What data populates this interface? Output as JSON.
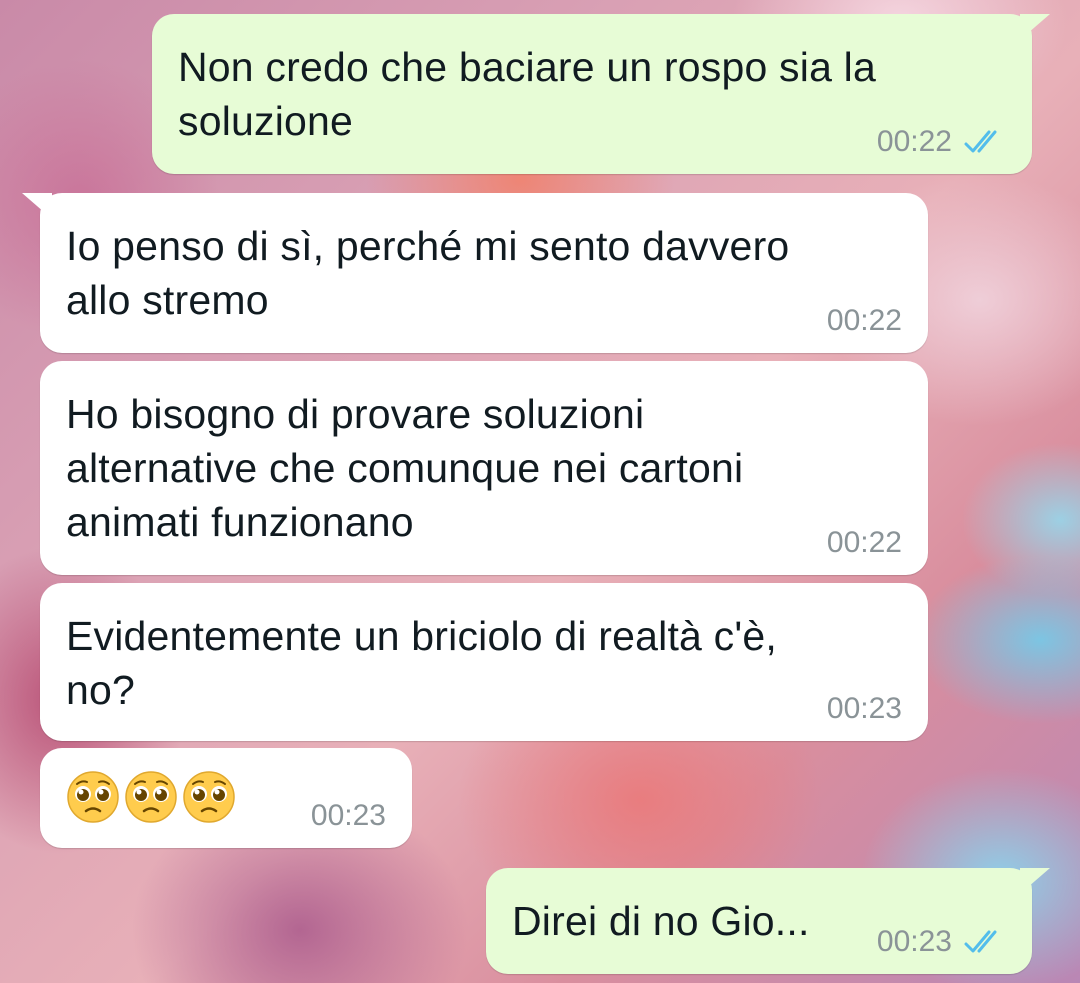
{
  "messages": [
    {
      "direction": "out",
      "text": "Non credo che baciare un rospo sia la\nsoluzione",
      "time": "00:22",
      "status": "read"
    },
    {
      "direction": "in",
      "text": "Io penso di sì, perché mi sento davvero\nallo stremo",
      "time": "00:22"
    },
    {
      "direction": "in",
      "text": "Ho bisogno di provare soluzioni\nalternative che comunque nei cartoni\nanimati funzionano",
      "time": "00:22"
    },
    {
      "direction": "in",
      "text": "Evidentemente un briciolo di realtà c'è,\nno?",
      "time": "00:23"
    },
    {
      "direction": "in",
      "emoji": [
        "pleading-face",
        "pleading-face",
        "pleading-face"
      ],
      "time": "00:23"
    },
    {
      "direction": "out",
      "text": "Direi di no Gio...",
      "time": "00:23",
      "status": "read"
    }
  ],
  "colors": {
    "outgoing_bubble": "#e7fcd6",
    "incoming_bubble": "#ffffff",
    "read_ticks": "#53bdeb",
    "timestamp": "#8a9397",
    "text": "#111b21"
  }
}
